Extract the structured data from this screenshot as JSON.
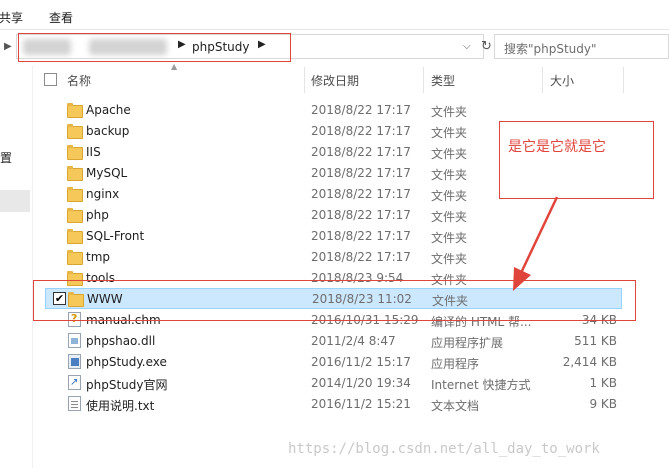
{
  "ribbon": {
    "tabs": [
      "共享",
      "查看"
    ]
  },
  "address": {
    "path": [
      "phpStudy"
    ]
  },
  "search": {
    "placeholder": "搜索\"phpStudy\""
  },
  "nav": {
    "fragment": "置"
  },
  "columns": {
    "name": "名称",
    "date": "修改日期",
    "type": "类型",
    "size": "大小"
  },
  "files": [
    {
      "name": "Apache",
      "date": "2018/8/22 17:17",
      "type": "文件夹",
      "size": "",
      "icon": "folder-icon"
    },
    {
      "name": "backup",
      "date": "2018/8/22 17:17",
      "type": "文件夹",
      "size": "",
      "icon": "folder-icon"
    },
    {
      "name": "IIS",
      "date": "2018/8/22 17:17",
      "type": "文件夹",
      "size": "",
      "icon": "folder-icon"
    },
    {
      "name": "MySQL",
      "date": "2018/8/22 17:17",
      "type": "文件夹",
      "size": "",
      "icon": "folder-icon"
    },
    {
      "name": "nginx",
      "date": "2018/8/22 17:17",
      "type": "文件夹",
      "size": "",
      "icon": "folder-icon"
    },
    {
      "name": "php",
      "date": "2018/8/22 17:17",
      "type": "文件夹",
      "size": "",
      "icon": "folder-icon"
    },
    {
      "name": "SQL-Front",
      "date": "2018/8/22 17:17",
      "type": "文件夹",
      "size": "",
      "icon": "folder-icon"
    },
    {
      "name": "tmp",
      "date": "2018/8/22 17:17",
      "type": "文件夹",
      "size": "",
      "icon": "folder-icon"
    },
    {
      "name": "tools",
      "date": "2018/8/23 9:54",
      "type": "文件夹",
      "size": "",
      "icon": "folder-icon"
    },
    {
      "name": "WWW",
      "date": "2018/8/23 11:02",
      "type": "文件夹",
      "size": "",
      "icon": "folder-icon",
      "selected": true
    },
    {
      "name": "manual.chm",
      "date": "2016/10/31 15:29",
      "type": "编译的 HTML 帮...",
      "size": "34 KB",
      "icon": "help-file-icon"
    },
    {
      "name": "phpshao.dll",
      "date": "2011/2/4 8:47",
      "type": "应用程序扩展",
      "size": "511 KB",
      "icon": "dll-file-icon"
    },
    {
      "name": "phpStudy.exe",
      "date": "2016/11/2 15:17",
      "type": "应用程序",
      "size": "2,414 KB",
      "icon": "exe-file-icon"
    },
    {
      "name": "phpStudy官网",
      "date": "2014/1/20 19:34",
      "type": "Internet 快捷方式",
      "size": "1 KB",
      "icon": "shortcut-file-icon"
    },
    {
      "name": "使用说明.txt",
      "date": "2016/11/2 15:21",
      "type": "文本文档",
      "size": "9 KB",
      "icon": "text-file-icon"
    }
  ],
  "annotation": {
    "text": "是它是它就是它",
    "color": "#e0453c"
  },
  "watermark": "https://blog.csdn.net/all_day_to_work",
  "colors": {
    "selection": "#cce8ff",
    "selection_border": "#99d1ff",
    "folder": "#f6c85a"
  }
}
